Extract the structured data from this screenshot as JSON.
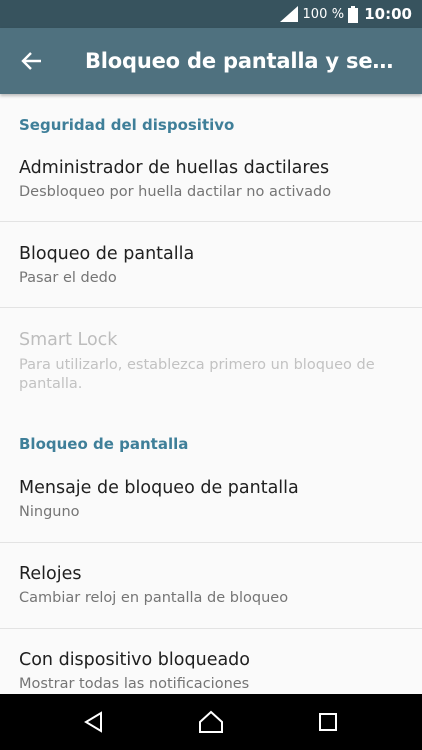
{
  "status_bar": {
    "battery_percent": "100 %",
    "time": "10:00",
    "icons": [
      "signal-icon",
      "battery-icon"
    ]
  },
  "toolbar": {
    "title": "Bloqueo de pantalla y seguridad",
    "back_icon": "back-arrow-icon"
  },
  "sections": [
    {
      "header": "Seguridad del dispositivo",
      "items": [
        {
          "title": "Administrador de huellas dactilares",
          "summary": "Desbloqueo por huella dactilar no activado",
          "enabled": true
        },
        {
          "title": "Bloqueo de pantalla",
          "summary": "Pasar el dedo",
          "enabled": true
        },
        {
          "title": "Smart Lock",
          "summary": "Para utilizarlo, establezca primero un bloqueo de pantalla.",
          "enabled": false
        }
      ]
    },
    {
      "header": "Bloqueo de pantalla",
      "items": [
        {
          "title": "Mensaje de bloqueo de pantalla",
          "summary": "Ninguno",
          "enabled": true
        },
        {
          "title": "Relojes",
          "summary": "Cambiar reloj en pantalla de bloqueo",
          "enabled": true
        },
        {
          "title": "Con dispositivo bloqueado",
          "summary": "Mostrar todas las notificaciones",
          "enabled": true
        }
      ]
    }
  ],
  "nav_bar": {
    "icons": [
      "back-triangle-icon",
      "home-icon",
      "recents-icon"
    ]
  },
  "colors": {
    "status_bar": "#37535e",
    "toolbar": "#4f717f",
    "accent": "#3f7f99",
    "background": "#fafafa"
  }
}
